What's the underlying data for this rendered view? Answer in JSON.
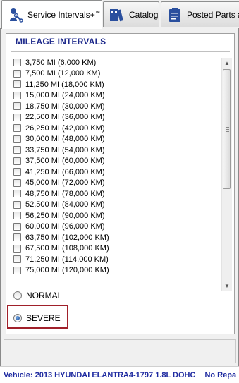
{
  "tabs": [
    {
      "label": "Service Intervals+",
      "tm": "™",
      "icon": "wrench-person-icon",
      "active": true
    },
    {
      "label": "Catalog",
      "icon": "binders-icon",
      "active": false
    },
    {
      "label": "Posted Parts a",
      "icon": "clipboard-icon",
      "active": false
    }
  ],
  "panel": {
    "heading": "MILEAGE INTERVALS",
    "intervals": [
      "3,750 MI (6,000 KM)",
      "7,500 MI (12,000 KM)",
      "11,250 MI (18,000 KM)",
      "15,000 MI (24,000 KM)",
      "18,750 MI (30,000 KM)",
      "22,500 MI (36,000 KM)",
      "26,250 MI (42,000 KM)",
      "30,000 MI (48,000 KM)",
      "33,750 MI (54,000 KM)",
      "37,500 MI (60,000 KM)",
      "41,250 MI (66,000 KM)",
      "45,000 MI (72,000 KM)",
      "48,750 MI (78,000 KM)",
      "52,500 MI (84,000 KM)",
      "56,250 MI (90,000 KM)",
      "60,000 MI (96,000 KM)",
      "63,750 MI (102,000 KM)",
      "67,500 MI (108,000 KM)",
      "71,250 MI (114,000 KM)",
      "75,000 MI (120,000 KM)"
    ],
    "conditions": {
      "normal": "NORMAL",
      "severe": "SEVERE",
      "selected": "SEVERE"
    }
  },
  "status": {
    "vehicle": "Vehicle: 2013 HYUNDAI ELANTRA4-1797 1.8L DOHC",
    "repair": "No Repa"
  },
  "colors": {
    "heading": "#1e2a8c",
    "status_text": "#1e2aa0",
    "highlight_border": "#a0202a"
  }
}
